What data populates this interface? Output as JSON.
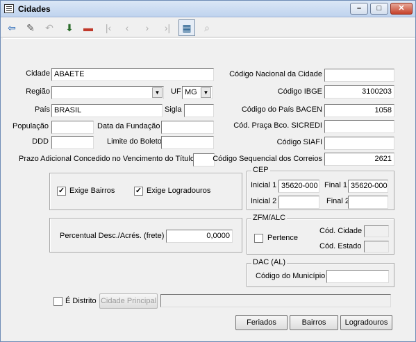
{
  "window": {
    "title": "Cidades"
  },
  "toolbar": {
    "icons": [
      "exit-icon",
      "edit-icon",
      "cancel-icon",
      "save-icon",
      "delete-icon",
      "first-record-icon",
      "previous-record-icon",
      "next-record-icon",
      "last-record-icon",
      "grid-icon",
      "search-icon"
    ]
  },
  "form": {
    "cidade_label": "Cidade",
    "cidade_value": "ABAETE",
    "regiao_label": "Região",
    "regiao_value": "",
    "uf_label": "UF",
    "uf_value": "MG",
    "pais_label": "País",
    "pais_value": "BRASIL",
    "sigla_label": "Sigla",
    "sigla_value": "",
    "populacao_label": "População",
    "populacao_value": "",
    "data_fundacao_label": "Data da Fundação",
    "data_fundacao_value": "",
    "ddd_label": "DDD",
    "ddd_value": "",
    "limite_boleto_label": "Limite do Boleto",
    "limite_boleto_value": "",
    "prazo_label": "Prazo Adicional Concedido no Vencimento do Título",
    "prazo_value": "",
    "codigo_nacional_label": "Código Nacional da Cidade",
    "codigo_nacional_value": "",
    "codigo_ibge_label": "Código IBGE",
    "codigo_ibge_value": "3100203",
    "codigo_pais_bacen_label": "Código do País BACEN",
    "codigo_pais_bacen_value": "1058",
    "praca_sicredi_label": "Cód. Praça Bco. SICREDI",
    "praca_sicredi_value": "",
    "codigo_siafi_label": "Código SIAFI",
    "codigo_siafi_value": "",
    "seq_correios_label": "Código Sequencial dos Correios",
    "seq_correios_value": "2621",
    "exige_bairros_label": "Exige Bairros",
    "exige_bairros_checked": true,
    "exige_logradouros_label": "Exige Logradouros",
    "exige_logradouros_checked": true,
    "percentual_label": "Percentual Desc./Acrés. (frete)",
    "percentual_value": "0,0000"
  },
  "cep": {
    "title": "CEP",
    "inicial1_label": "Inicial 1",
    "inicial1_value": "35620-000",
    "final1_label": "Final 1",
    "final1_value": "35620-000",
    "inicial2_label": "Inicial 2",
    "inicial2_value": "",
    "final2_label": "Final 2",
    "final2_value": ""
  },
  "zfm": {
    "title": "ZFM/ALC",
    "pertence_label": "Pertence",
    "pertence_checked": false,
    "cod_cidade_label": "Cód. Cidade",
    "cod_cidade_value": "",
    "cod_estado_label": "Cód. Estado",
    "cod_estado_value": ""
  },
  "dac": {
    "title": "DAC (AL)",
    "cod_municipio_label": "Código do Município",
    "cod_municipio_value": ""
  },
  "distrito": {
    "label": "É Distrito",
    "checked": false,
    "cidade_principal_button": "Cidade Principal",
    "cidade_principal_value": ""
  },
  "buttons": {
    "feriados": "Feriados",
    "bairros": "Bairros",
    "logradouros": "Logradouros"
  }
}
